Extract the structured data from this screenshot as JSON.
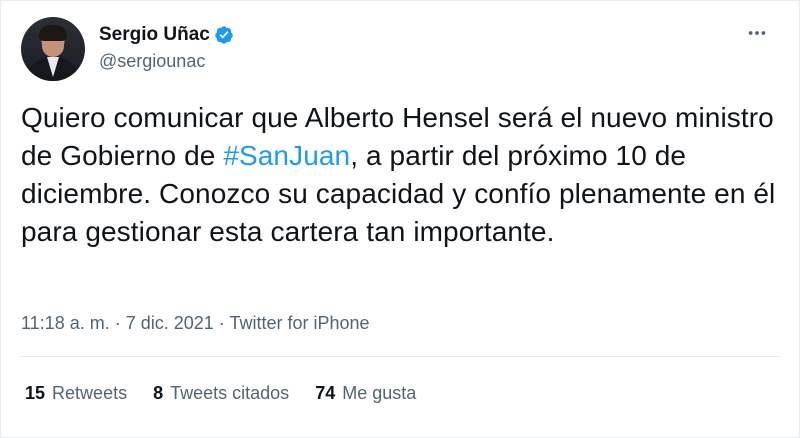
{
  "tweet": {
    "author": {
      "display_name": "Sergio Uñac",
      "handle": "@sergiounac",
      "verified": true
    },
    "text_before": "Quiero comunicar que Alberto Hensel será el nuevo ministro de Gobierno de ",
    "hashtag": "#SanJuan",
    "text_after": ", a partir del próximo 10 de diciembre. Conozco su capacidad y confío plenamente en él para gestionar esta cartera tan importante.",
    "time": "11:18 a. m.",
    "separator": " · ",
    "date": "7 dic. 2021",
    "source": "Twitter for iPhone",
    "stats": {
      "retweets_count": "15",
      "retweets_label": "Retweets",
      "quotes_count": "8",
      "quotes_label": "Tweets citados",
      "likes_count": "74",
      "likes_label": "Me gusta"
    }
  },
  "colors": {
    "accent": "#1d9bf0",
    "text_primary": "#0f1419",
    "text_secondary": "#536471"
  },
  "icons": {
    "verified": "verified-badge-icon",
    "more": "more-horizontal-icon"
  }
}
